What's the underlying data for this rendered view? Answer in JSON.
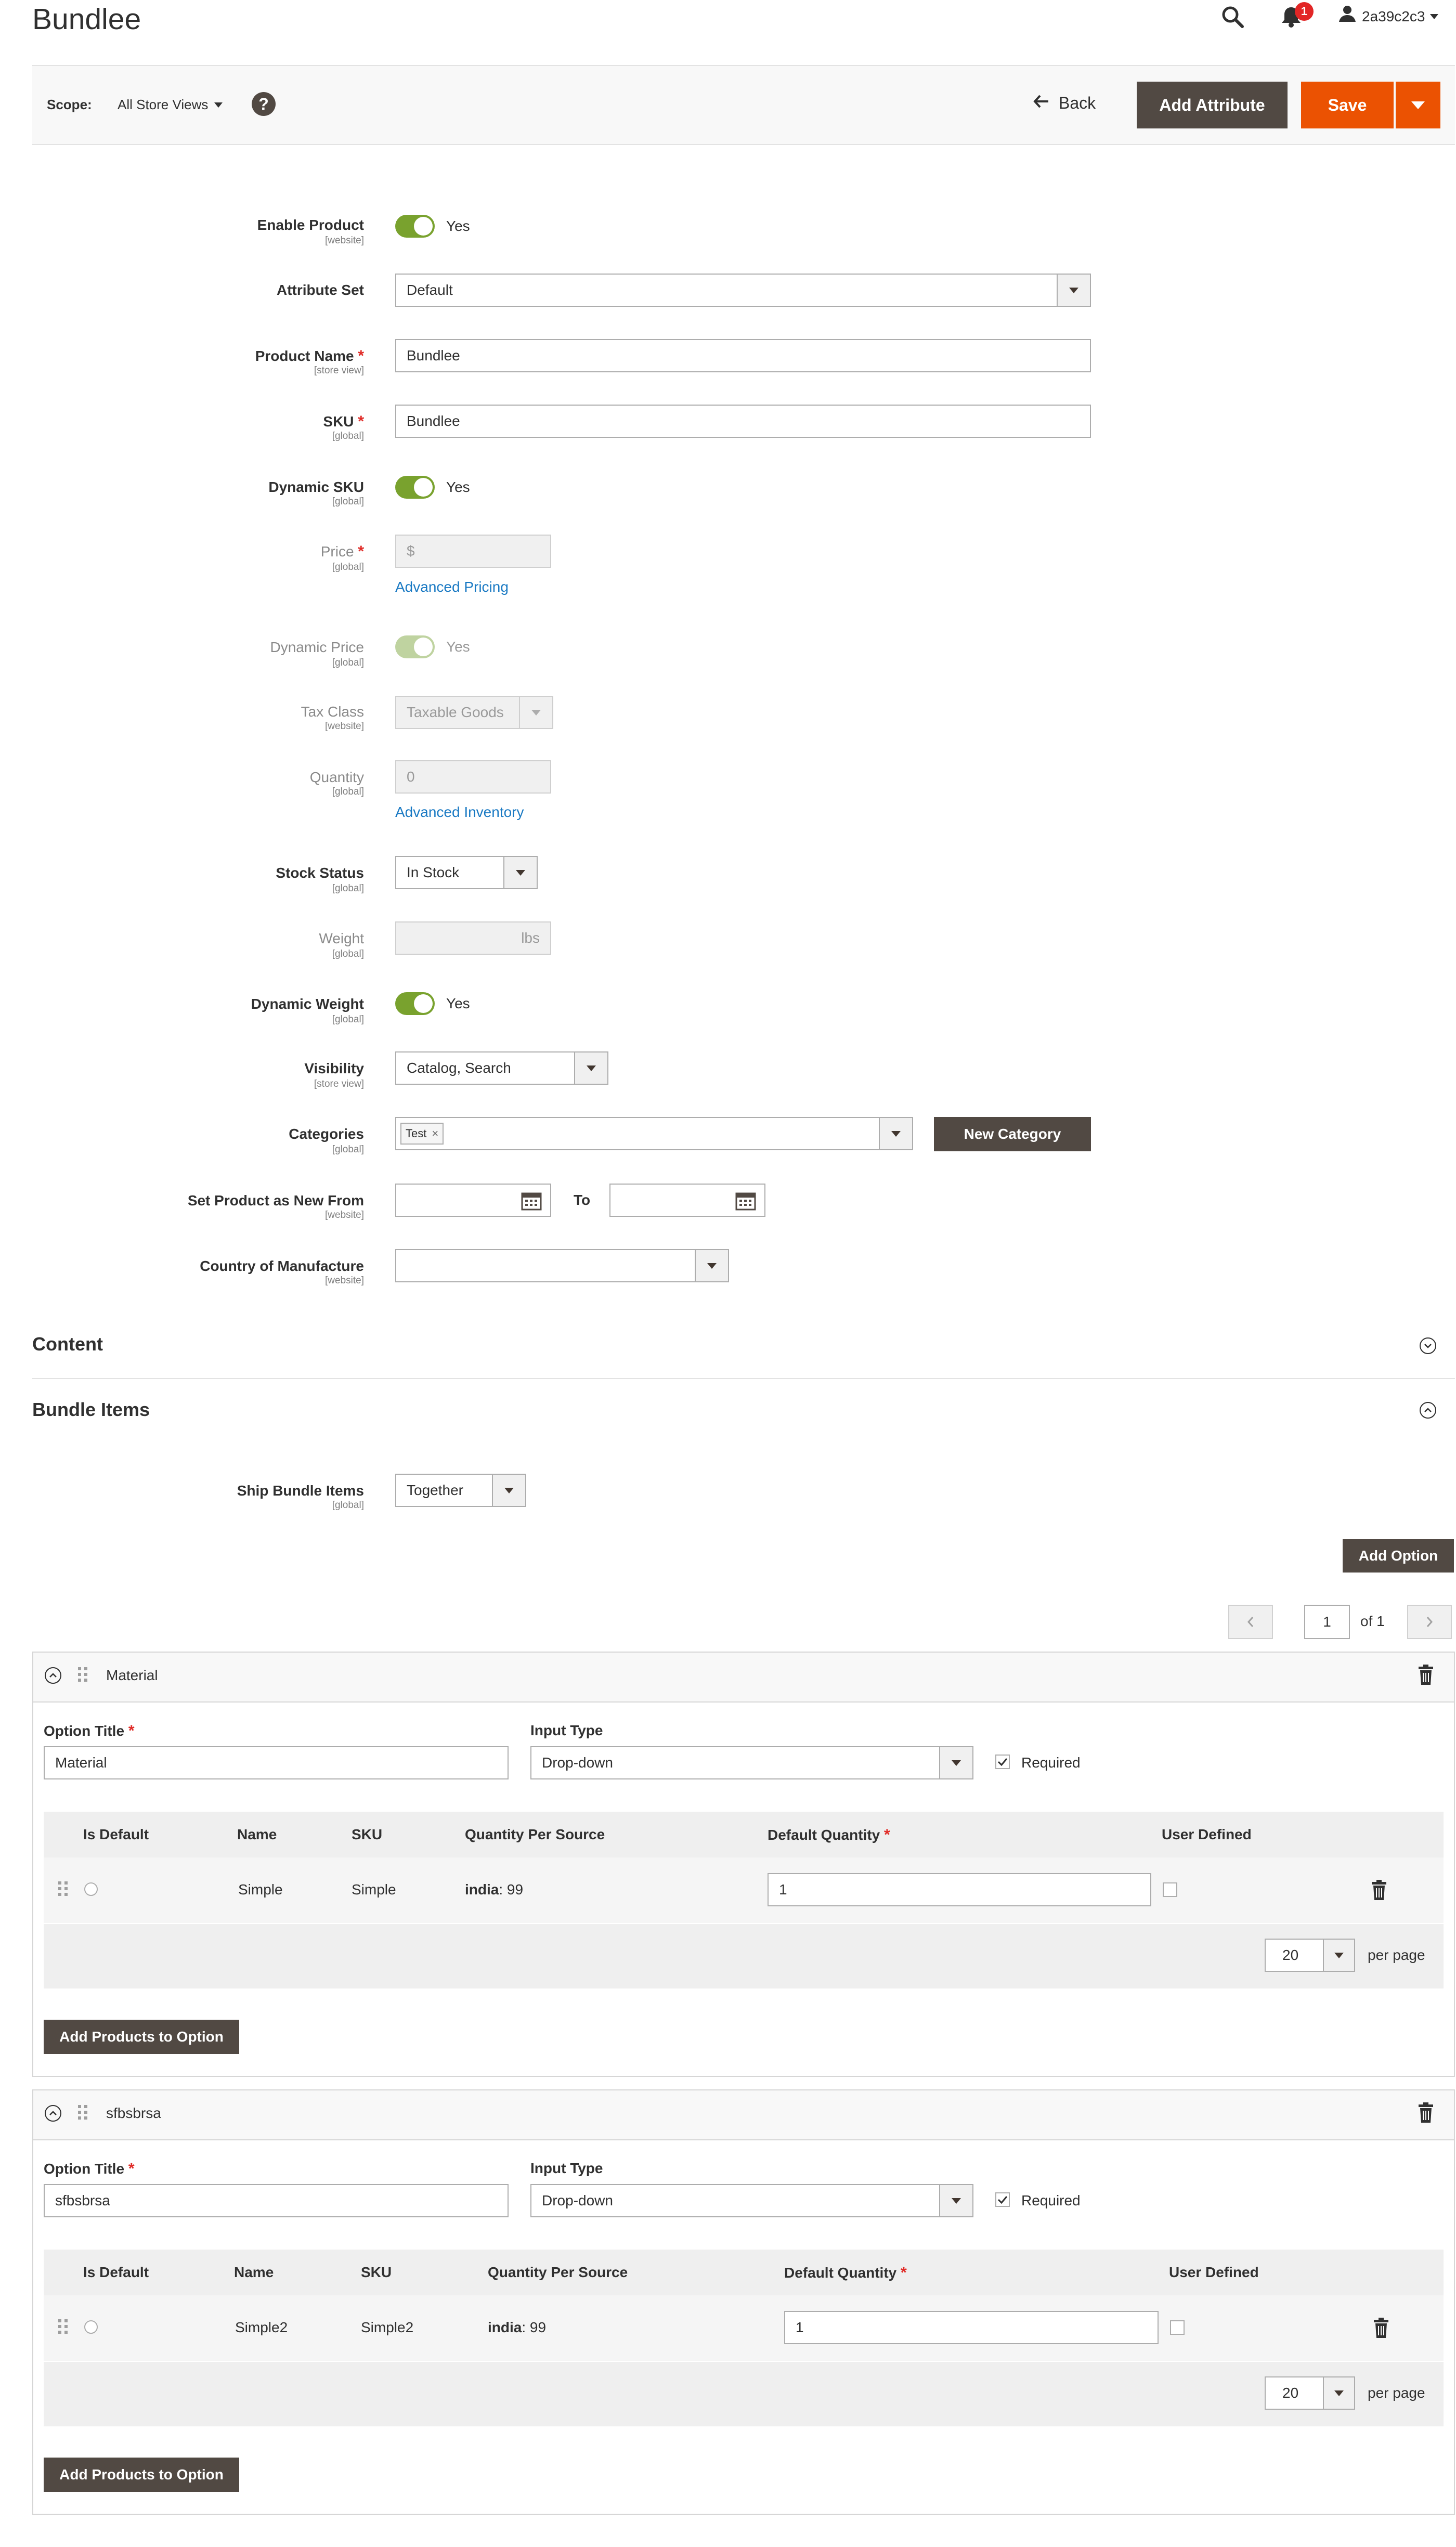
{
  "page": {
    "title": "Bundlee",
    "notification_count": "1",
    "user_name": "2a39c2c3"
  },
  "scope": {
    "label": "Scope:",
    "value": "All Store Views",
    "help_icon": "?"
  },
  "actions": {
    "back": "Back",
    "add_attribute": "Add Attribute",
    "save": "Save"
  },
  "form": {
    "enable_product": {
      "label": "Enable Product",
      "scope": "[website]",
      "value": "Yes"
    },
    "attribute_set": {
      "label": "Attribute Set",
      "value": "Default"
    },
    "product_name": {
      "label": "Product Name",
      "scope": "[store view]",
      "value": "Bundlee"
    },
    "sku": {
      "label": "SKU",
      "scope": "[global]",
      "value": "Bundlee"
    },
    "dynamic_sku": {
      "label": "Dynamic SKU",
      "scope": "[global]",
      "value": "Yes"
    },
    "price": {
      "label": "Price",
      "scope": "[global]",
      "prefix": "$",
      "link": "Advanced Pricing"
    },
    "dynamic_price": {
      "label": "Dynamic Price",
      "scope": "[global]",
      "value": "Yes"
    },
    "tax_class": {
      "label": "Tax Class",
      "scope": "[website]",
      "value": "Taxable Goods"
    },
    "quantity": {
      "label": "Quantity",
      "scope": "[global]",
      "value": "0",
      "link": "Advanced Inventory"
    },
    "stock_status": {
      "label": "Stock Status",
      "scope": "[global]",
      "value": "In Stock"
    },
    "weight": {
      "label": "Weight",
      "scope": "[global]",
      "unit": "lbs"
    },
    "dynamic_weight": {
      "label": "Dynamic Weight",
      "scope": "[global]",
      "value": "Yes"
    },
    "visibility": {
      "label": "Visibility",
      "scope": "[store view]",
      "value": "Catalog, Search"
    },
    "categories": {
      "label": "Categories",
      "scope": "[global]",
      "tag": "Test",
      "tag_remove": "×",
      "new_button": "New Category"
    },
    "new_from": {
      "label": "Set Product as New From",
      "scope": "[website]",
      "to_label": "To"
    },
    "country": {
      "label": "Country of Manufacture",
      "scope": "[website]"
    }
  },
  "sections": {
    "content": "Content",
    "bundle_items": "Bundle Items"
  },
  "bundle": {
    "ship_label": "Ship Bundle Items",
    "ship_scope": "[global]",
    "ship_value": "Together",
    "add_option": "Add Option",
    "pager": {
      "page": "1",
      "of": "of 1"
    },
    "option_title_label": "Option Title",
    "input_type_label": "Input Type",
    "required_label": "Required",
    "columns": [
      "Is Default",
      "Name",
      "SKU",
      "Quantity Per Source",
      "Default Quantity",
      "User Defined"
    ],
    "per_page_value": "20",
    "per_page_label": "per page",
    "add_products": "Add Products to Option",
    "options": [
      {
        "header": "Material",
        "title": "Material",
        "input_type": "Drop-down",
        "row": {
          "name": "Simple",
          "sku": "Simple",
          "source": "india",
          "qty": ": 99",
          "default_qty": "1"
        }
      },
      {
        "header": "sfbsbrsa",
        "title": "sfbsbrsa",
        "input_type": "Drop-down",
        "row": {
          "name": "Simple2",
          "sku": "Simple2",
          "source": "india",
          "qty": ": 99",
          "default_qty": "1"
        }
      }
    ]
  },
  "colors": {
    "accent_orange": "#eb5202",
    "button_dark": "#514943",
    "toggle_green": "#79a22e",
    "link_blue": "#1979c3",
    "required_red": "#e02b27"
  }
}
